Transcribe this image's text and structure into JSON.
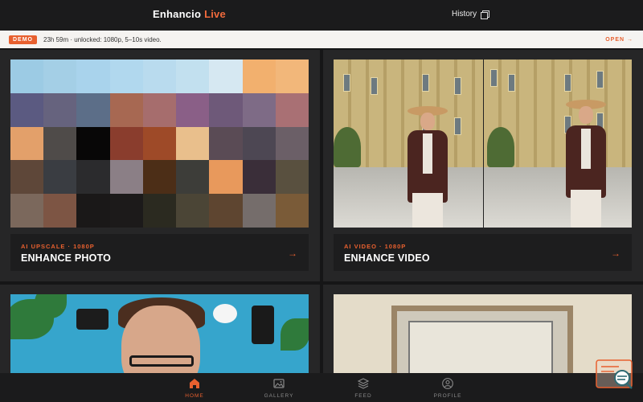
{
  "header": {
    "brand_name": "Enhancio",
    "brand_suffix": "Live",
    "history_label": "History",
    "history_icon": "history-icon"
  },
  "banner": {
    "badge": "DEMO",
    "text": "23h 59m · unlocked: 1080p, 5–10s video.",
    "action": "OPEN →"
  },
  "cards": [
    {
      "subtitle": "AI UPSCALE · 1080P",
      "title": "ENHANCE PHOTO",
      "arrow": "→"
    },
    {
      "subtitle": "AI VIDEO · 1080P",
      "title": "ENHANCE VIDEO",
      "arrow": "→"
    }
  ],
  "nav": {
    "items": [
      {
        "label": "HOME",
        "icon": "home-icon",
        "active": true
      },
      {
        "label": "GALLERY",
        "icon": "gallery-icon",
        "active": false
      },
      {
        "label": "FEED",
        "icon": "feed-icon",
        "active": false
      },
      {
        "label": "PROFILE",
        "icon": "profile-icon",
        "active": false
      }
    ]
  },
  "colors": {
    "accent": "#e8602f",
    "background": "#1b1b1c",
    "card": "#262627",
    "banner": "#f5f3f1"
  },
  "pixel_colors": [
    "#9ccbe4",
    "#a4cfe6",
    "#a9d3ec",
    "#b1d8ee",
    "#b9dbee",
    "#c2e0ef",
    "#d6e8f2",
    "#f2b06e",
    "#f2b77a",
    "#5b5a81",
    "#66637e",
    "#5c6e88",
    "#a76852",
    "#a66d6d",
    "#8a5f87",
    "#6e5979",
    "#7e6b86",
    "#a97074",
    "#e3a06a",
    "#4f4b49",
    "#080707",
    "#8a3d2d",
    "#9e4a28",
    "#e9bf8c",
    "#5a4b55",
    "#4d4753",
    "#6b5f67",
    "#5e4739",
    "#3a3d42",
    "#2b2b2d",
    "#8b7f86",
    "#4c2e17",
    "#3d3d39",
    "#e8995c",
    "#3a2e39",
    "#59503f",
    "#7b685c",
    "#7d5544",
    "#1a1818",
    "#1c1a1a",
    "#2b2a20",
    "#4b4536",
    "#5e4530",
    "#756d6b",
    "#7a5b38"
  ]
}
